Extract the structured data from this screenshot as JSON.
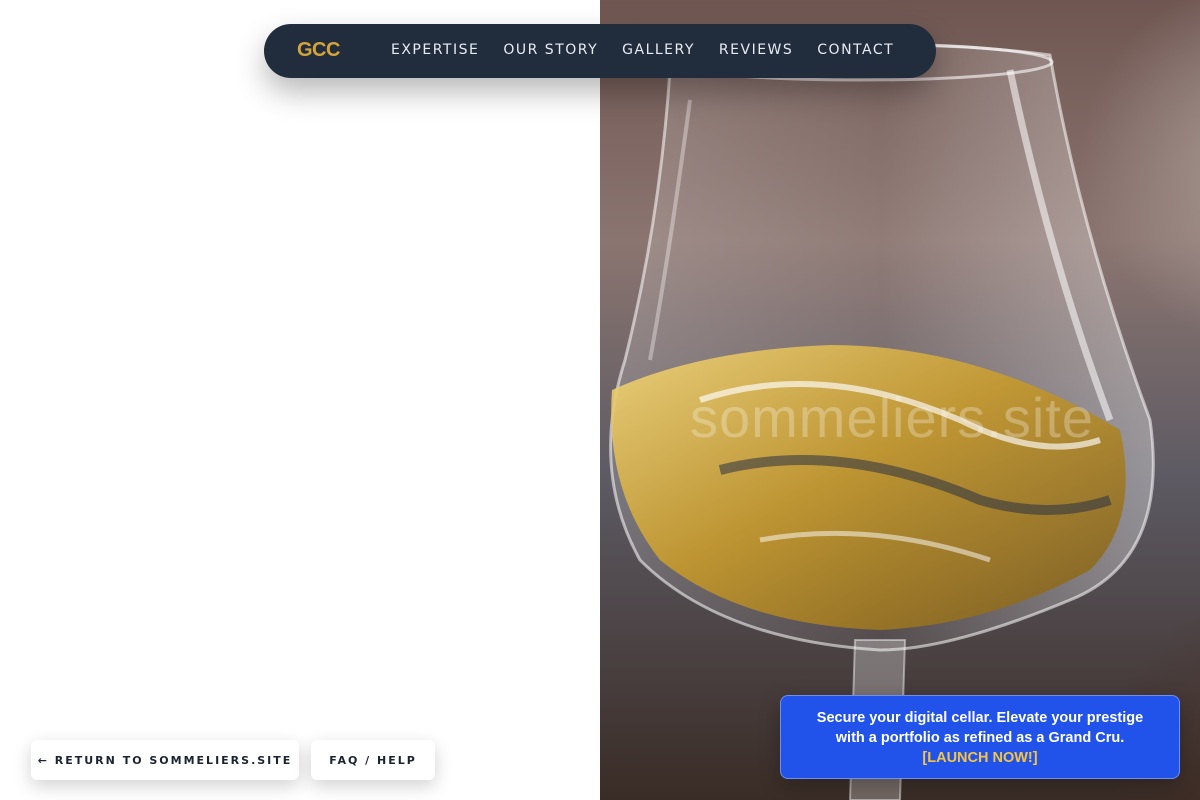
{
  "nav": {
    "logo": "GCC",
    "links": [
      "EXPERTISE",
      "OUR STORY",
      "GALLERY",
      "REVIEWS",
      "CONTACT"
    ]
  },
  "hero": {
    "watermark": "sommeliers.site"
  },
  "footer_buttons": {
    "return_label": "← RETURN TO SOMMELIERS.SITE",
    "faq_label": "FAQ / HELP"
  },
  "promo": {
    "text": "Secure your digital cellar. Elevate your prestige with a portfolio as refined as a Grand Cru.",
    "cta": "[LAUNCH NOW!]"
  },
  "colors": {
    "nav_bg": "#212c3d",
    "logo": "#d4a43a",
    "promo_bg": "#2153ea",
    "promo_cta": "#f5c542"
  }
}
